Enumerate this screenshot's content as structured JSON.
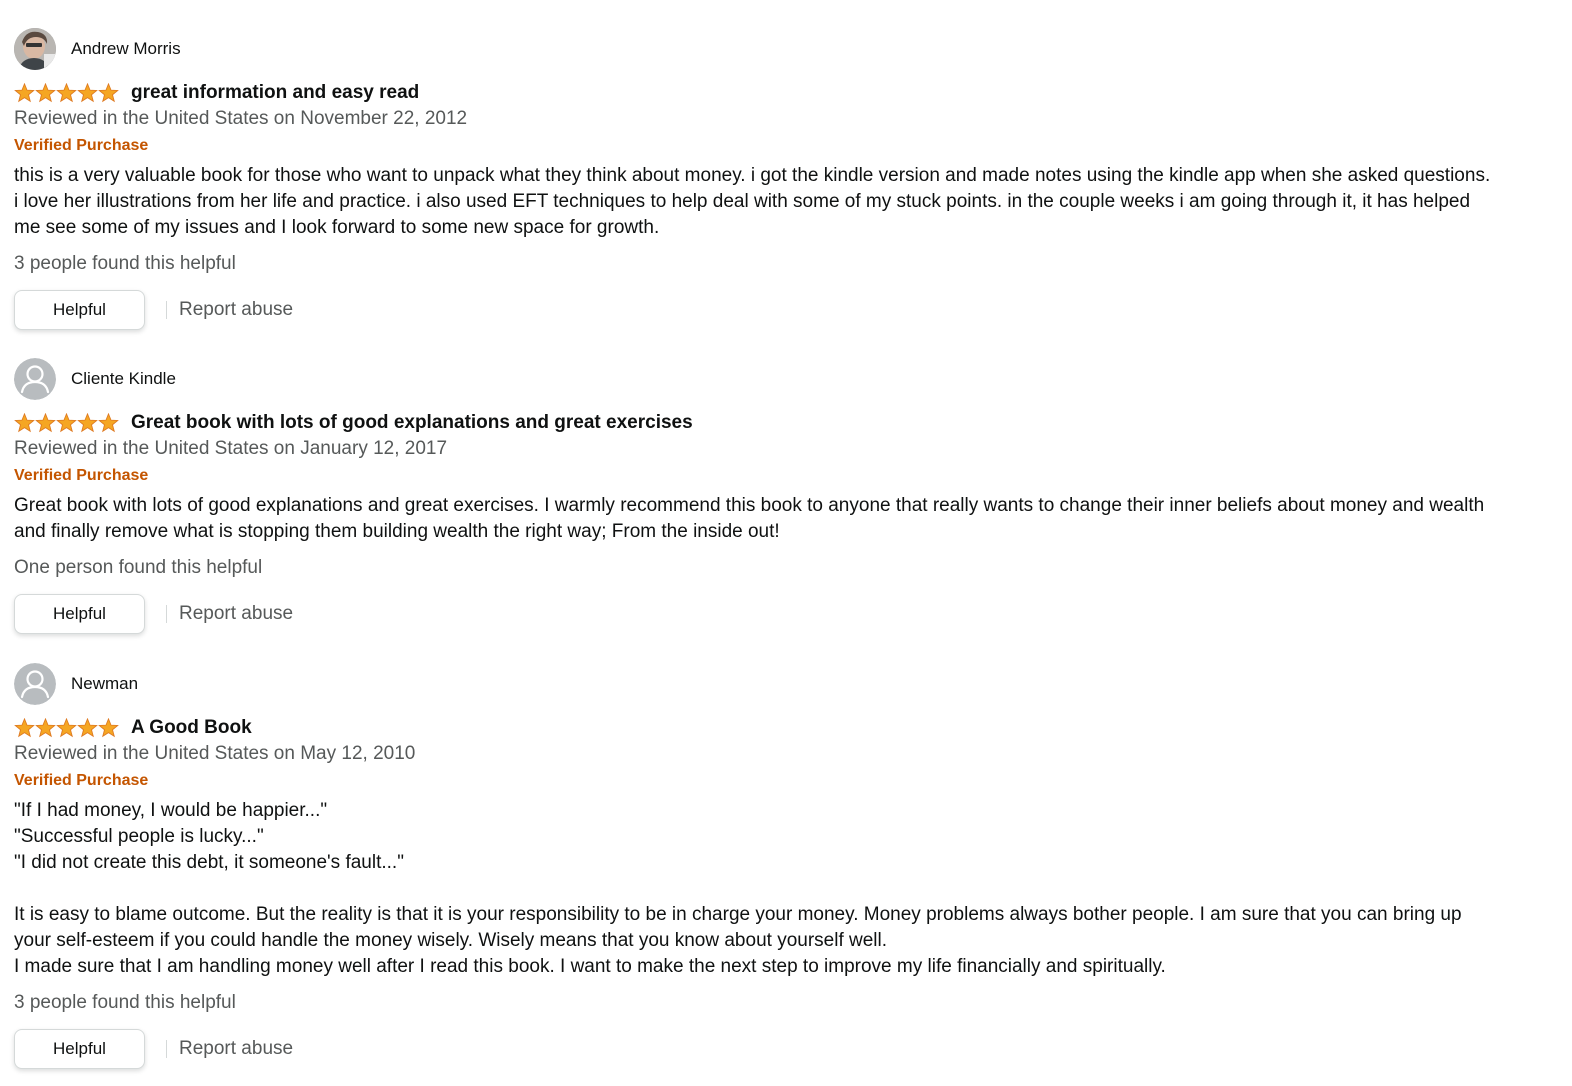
{
  "reviews": [
    {
      "reviewer": "Andrew Morris",
      "avatar_icon": "reviewer-photo-icon",
      "rating": 5,
      "rating_max": 5,
      "title": "great information and easy read",
      "date": "Reviewed in the United States on November 22, 2012",
      "verified": "Verified Purchase",
      "body": "this is a very valuable book for those who want to unpack what they think about money. i got the kindle version and made notes using the kindle app when she asked questions.\ni love her illustrations from her life and practice. i also used EFT techniques to help deal with some of my stuck points. in the couple weeks i am going through it, it has helped\nme see some of my issues and I look forward to some new space for growth.",
      "helpful_count": "3 people found this helpful",
      "helpful_label": "Helpful",
      "report_label": "Report abuse"
    },
    {
      "reviewer": "Cliente Kindle",
      "avatar_icon": "default-user-icon",
      "rating": 5,
      "rating_max": 5,
      "title": "Great book with lots of good explanations and great exercises",
      "date": "Reviewed in the United States on January 12, 2017",
      "verified": "Verified Purchase",
      "body": "Great book with lots of good explanations and great exercises. I warmly recommend this book to anyone that really wants to change their inner beliefs about money and wealth\nand finally remove what is stopping them building wealth the right way; From the inside out!",
      "helpful_count": "One person found this helpful",
      "helpful_label": "Helpful",
      "report_label": "Report abuse"
    },
    {
      "reviewer": "Newman",
      "avatar_icon": "default-user-icon",
      "rating": 5,
      "rating_max": 5,
      "title": "A Good Book",
      "date": "Reviewed in the United States on May 12, 2010",
      "verified": "Verified Purchase",
      "body": "\"If I had money, I would be happier...\"\n\"Successful people is lucky...\"\n\"I did not create this debt, it someone's fault...\"\n\nIt is easy to blame outcome. But the reality is that it is your responsibility to be in charge your money. Money problems always bother people. I am sure that you can bring up\nyour self-esteem if you could handle the money wisely. Wisely means that you know about yourself well.\nI made sure that I am handling money well after I read this book. I want to make the next step to improve my life financially and spiritually.",
      "helpful_count": "3 people found this helpful",
      "helpful_label": "Helpful",
      "report_label": "Report abuse"
    }
  ],
  "colors": {
    "star": "#f5a623",
    "verified": "#c45500",
    "muted_text": "#565959",
    "text": "#0f1111",
    "button_border": "#d5d9d9"
  }
}
